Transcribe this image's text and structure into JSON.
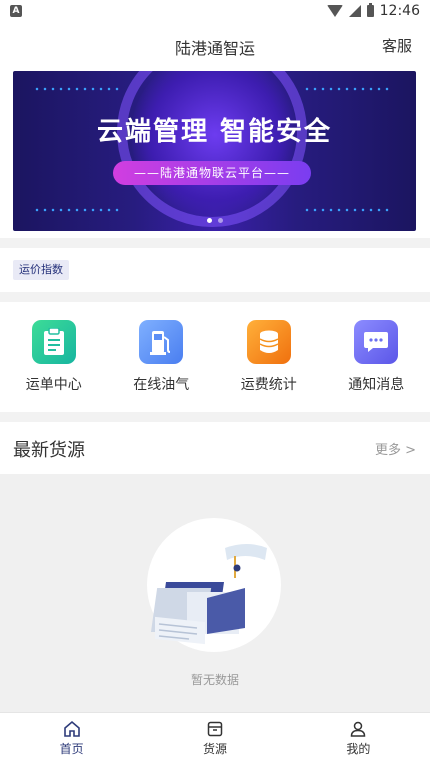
{
  "status": {
    "left_icon": "A",
    "time": "12:46"
  },
  "header": {
    "title": "陆港通智运",
    "service": "客服"
  },
  "banner": {
    "headline": "云端管理 智能安全",
    "subtitle": "——陆港通物联云平台——"
  },
  "price_index": "运价指数",
  "grid": [
    {
      "label": "运单中心",
      "icon": "clipboard-icon",
      "color": "#20c997"
    },
    {
      "label": "在线油气",
      "icon": "fuel-pump-icon",
      "color": "#5b8ef5"
    },
    {
      "label": "运费统计",
      "icon": "coin-stack-icon",
      "color": "#f5921e"
    },
    {
      "label": "通知消息",
      "icon": "chat-icon",
      "color": "#6b6ff0"
    }
  ],
  "latest": {
    "title": "最新货源",
    "more": "更多 >"
  },
  "empty": {
    "text": "暂无数据"
  },
  "tabs": [
    {
      "label": "首页",
      "icon": "home-icon"
    },
    {
      "label": "货源",
      "icon": "cargo-box-icon"
    },
    {
      "label": "我的",
      "icon": "user-icon"
    }
  ]
}
